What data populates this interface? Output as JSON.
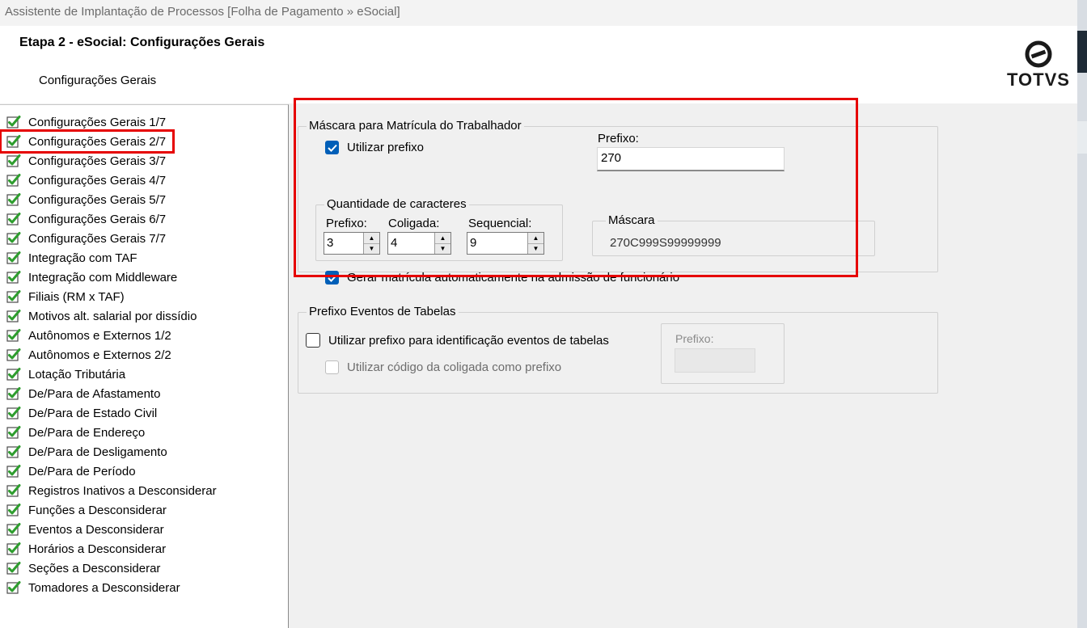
{
  "window": {
    "title": "Assistente de Implantação de Processos [Folha de Pagamento » eSocial]"
  },
  "header": {
    "step_title": "Etapa 2 - eSocial: Configurações Gerais",
    "step_subtitle": "Configurações Gerais",
    "logo_text": "TOTVS"
  },
  "tree": {
    "items": [
      {
        "label": "Configurações Gerais 1/7",
        "icon": "green-check-icon"
      },
      {
        "label": "Configurações Gerais 2/7",
        "icon": "green-check-icon",
        "selected": true
      },
      {
        "label": "Configurações Gerais 3/7",
        "icon": "green-check-icon"
      },
      {
        "label": "Configurações Gerais 4/7",
        "icon": "green-check-icon"
      },
      {
        "label": "Configurações Gerais 5/7",
        "icon": "green-check-icon"
      },
      {
        "label": "Configurações Gerais 6/7",
        "icon": "green-check-icon"
      },
      {
        "label": "Configurações Gerais 7/7",
        "icon": "green-check-icon"
      },
      {
        "label": "Integração com TAF",
        "icon": "green-check-icon"
      },
      {
        "label": "Integração com Middleware",
        "icon": "green-check-icon"
      },
      {
        "label": "Filiais (RM x TAF)",
        "icon": "green-check-icon"
      },
      {
        "label": "Motivos alt. salarial por dissídio",
        "icon": "green-check-icon"
      },
      {
        "label": "Autônomos e Externos 1/2",
        "icon": "green-check-icon"
      },
      {
        "label": "Autônomos e Externos 2/2",
        "icon": "green-check-icon"
      },
      {
        "label": "Lotação Tributária",
        "icon": "green-check-icon"
      },
      {
        "label": "De/Para de Afastamento",
        "icon": "green-check-icon"
      },
      {
        "label": "De/Para de Estado Civil",
        "icon": "green-check-icon"
      },
      {
        "label": "De/Para de Endereço",
        "icon": "green-check-icon"
      },
      {
        "label": "De/Para de Desligamento",
        "icon": "green-check-icon"
      },
      {
        "label": "De/Para de Período",
        "icon": "green-check-icon"
      },
      {
        "label": "Registros Inativos a Desconsiderar",
        "icon": "green-check-icon"
      },
      {
        "label": "Funções a Desconsiderar",
        "icon": "green-check-icon"
      },
      {
        "label": "Eventos a Desconsiderar",
        "icon": "green-check-icon"
      },
      {
        "label": "Horários a Desconsiderar",
        "icon": "green-check-icon"
      },
      {
        "label": "Seções a Desconsiderar",
        "icon": "green-check-icon"
      },
      {
        "label": "Tomadores a Desconsiderar",
        "icon": "green-check-icon"
      }
    ]
  },
  "mask_group": {
    "legend": "Máscara para Matrícula do Trabalhador",
    "use_prefix_label": "Utilizar prefixo",
    "use_prefix_checked": true,
    "prefix_label": "Prefixo:",
    "prefix_value": "270",
    "quantity_legend": "Quantidade de caracteres",
    "prefix_qty_label": "Prefixo:",
    "prefix_qty_value": "3",
    "coligada_label": "Coligada:",
    "coligada_value": "4",
    "sequencial_label": "Sequencial:",
    "sequencial_value": "9",
    "mask_legend": "Máscara",
    "mask_value": "270C999S99999999",
    "auto_generate_label": "Gerar matrícula automaticamente na admissão de funcionário",
    "auto_generate_checked": true
  },
  "table_events_group": {
    "legend": "Prefixo Eventos de Tabelas",
    "use_prefix_label": "Utilizar prefixo para identificação eventos de tabelas",
    "use_prefix_checked": false,
    "use_coligada_label": "Utilizar código da coligada como prefixo",
    "use_coligada_checked": false,
    "prefix_label": "Prefixo:"
  },
  "colors": {
    "highlight_red": "#e60000",
    "checkbox_blue": "#005fb8",
    "check_green": "#2e9d2e"
  }
}
